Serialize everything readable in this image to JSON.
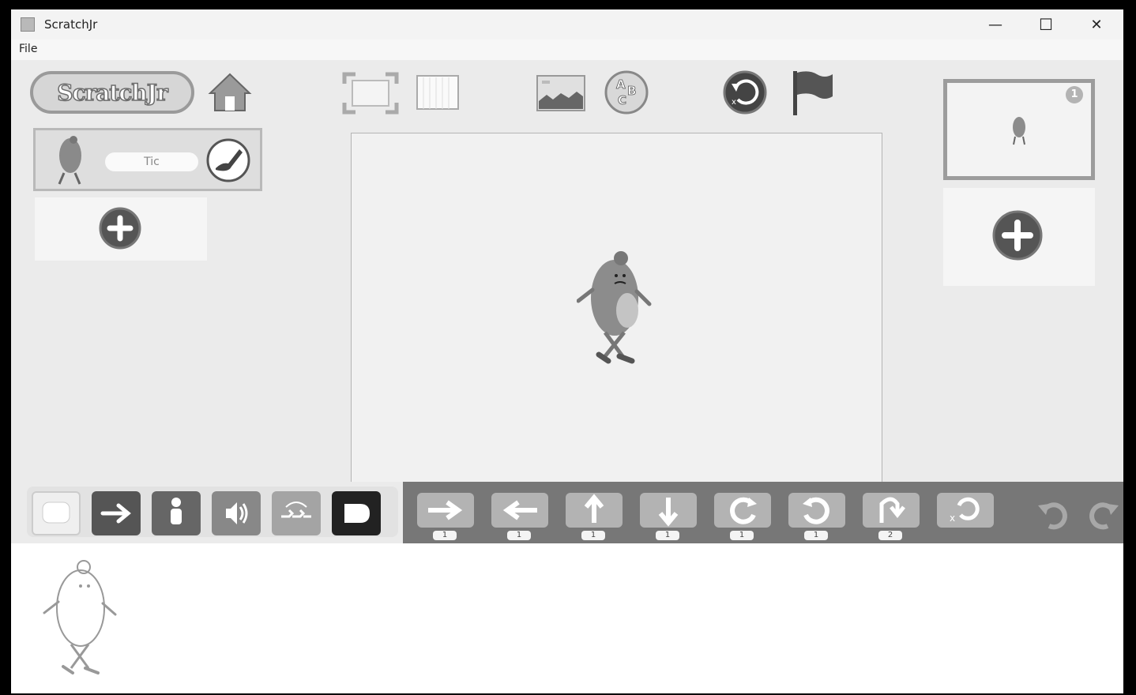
{
  "window": {
    "title": "ScratchJr",
    "minimize_label": "—",
    "maximize_label": "☐",
    "close_label": "✕"
  },
  "menu": {
    "file_label": "File"
  },
  "header": {
    "logo_text": "ScratchJr"
  },
  "sprites_panel": {
    "selected_sprite_name": "Tic"
  },
  "pages_panel": {
    "current_page_number": "1"
  },
  "palette": {
    "categories": [
      {
        "icon": "trigger-icon"
      },
      {
        "icon": "motion-arrow-icon"
      },
      {
        "icon": "looks-person-icon"
      },
      {
        "icon": "sound-speaker-icon"
      },
      {
        "icon": "control-icon"
      },
      {
        "icon": "end-icon"
      }
    ],
    "motion_blocks": [
      {
        "icon": "move-right-icon",
        "value": "1"
      },
      {
        "icon": "move-left-icon",
        "value": "1"
      },
      {
        "icon": "move-up-icon",
        "value": "1"
      },
      {
        "icon": "move-down-icon",
        "value": "1"
      },
      {
        "icon": "turn-right-icon",
        "value": "1"
      },
      {
        "icon": "turn-left-icon",
        "value": "1"
      },
      {
        "icon": "hop-icon",
        "value": "2"
      },
      {
        "icon": "go-home-icon"
      }
    ]
  },
  "colors": {
    "stage_bg": "#f1f1f1",
    "palette_bg": "#777777",
    "app_bg": "#ebebeb"
  }
}
